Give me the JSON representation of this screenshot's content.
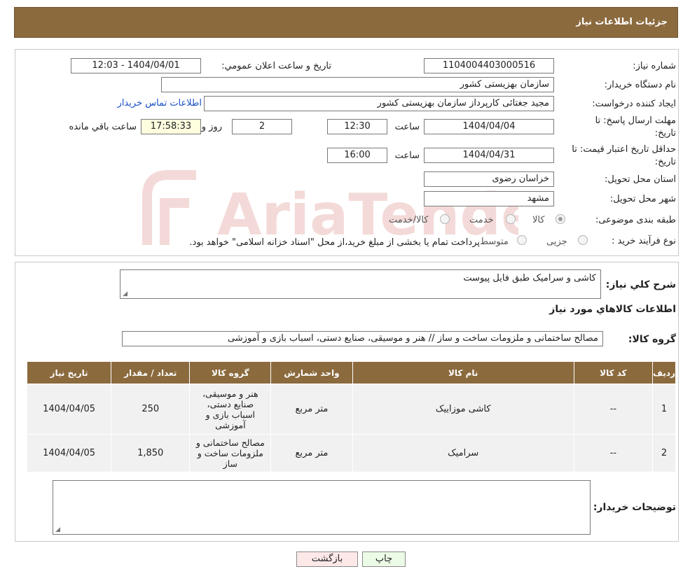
{
  "header": {
    "title": "جزئیات اطلاعات نیاز"
  },
  "form": {
    "need_number": {
      "label": "شماره نیاز:",
      "value": "1104004403000516"
    },
    "announce_datetime": {
      "label": "تاریخ و ساعت اعلان عمومي:",
      "value": "1404/04/01 - 12:03"
    },
    "buyer_org": {
      "label": "نام دستگاه خریدار:",
      "value": "سازمان بهزیستی کشور"
    },
    "requester": {
      "label": "ایجاد کننده درخواست:",
      "value": "مجید جغتائی کارپرداز سازمان بهزیستی کشور",
      "contact_link": "اطلاعات تماس خریدار"
    },
    "reply_deadline": {
      "label_line1": "مهلت ارسال پاسخ: تا",
      "label_line2": "تاریخ:",
      "date": "1404/04/04",
      "time_label": "ساعت",
      "time": "12:30",
      "days": "2",
      "days_label": "روز و",
      "remaining": "17:58:33",
      "remaining_label": "ساعت باقي مانده"
    },
    "price_validity": {
      "label_line1": "حداقل تاریخ اعتبار قیمت: تا",
      "label_line2": "تاریخ:",
      "date": "1404/04/31",
      "time_label": "ساعت",
      "time": "16:00"
    },
    "province": {
      "label": "استان محل تحویل:",
      "value": "خراسان رضوی"
    },
    "city": {
      "label": "شهر محل تحویل:",
      "value": "مشهد"
    },
    "category": {
      "label": "طبقه بندی موضوعی:",
      "options": [
        "کالا",
        "خدمت",
        "کالا/خدمت"
      ],
      "selected": 0
    },
    "purchase_type": {
      "label": "نوع فرآیند خرید :",
      "options": [
        "جزیی",
        "متوسط"
      ],
      "note": "پرداخت تمام یا بخشی از مبلغ خرید،از محل \"اسناد خزانه اسلامی\" خواهد بود."
    }
  },
  "description": {
    "label": "شرح كلي نياز:",
    "value": "کاشی و سرامیک طبق فایل پیوست"
  },
  "goods_section": {
    "title": "اطلاعات كالاهاي مورد نياز"
  },
  "goods_group": {
    "label": "گروه كالا:",
    "value": "مصالح ساختمانی و ملزومات ساخت و ساز // هنر و موسیقی، صنایع دستی، اسباب بازی و آموزشی"
  },
  "table": {
    "headers": [
      "ردیف",
      "کد کالا",
      "نام کالا",
      "واحد شمارش",
      "گروه کالا",
      "تعداد / مقدار",
      "تاریخ نیاز"
    ],
    "rows": [
      {
        "row": "1",
        "code": "--",
        "name": "کاشی موزاییک",
        "unit": "متر مربع",
        "group": "هنر و موسیقی، صنایع دستی، اسباب بازی و آموزشی",
        "qty": "250",
        "date": "1404/04/05"
      },
      {
        "row": "2",
        "code": "--",
        "name": "سرامیک",
        "unit": "متر مربع",
        "group": "مصالح ساختمانی و ملزومات ساخت و ساز",
        "qty": "1,850",
        "date": "1404/04/05"
      }
    ]
  },
  "buyer_notes": {
    "label": "توضیحات خریدار:",
    "value": ""
  },
  "buttons": {
    "print": "چاپ",
    "back": "بازگشت"
  },
  "watermark": {
    "text": "AriaTender.neT"
  }
}
